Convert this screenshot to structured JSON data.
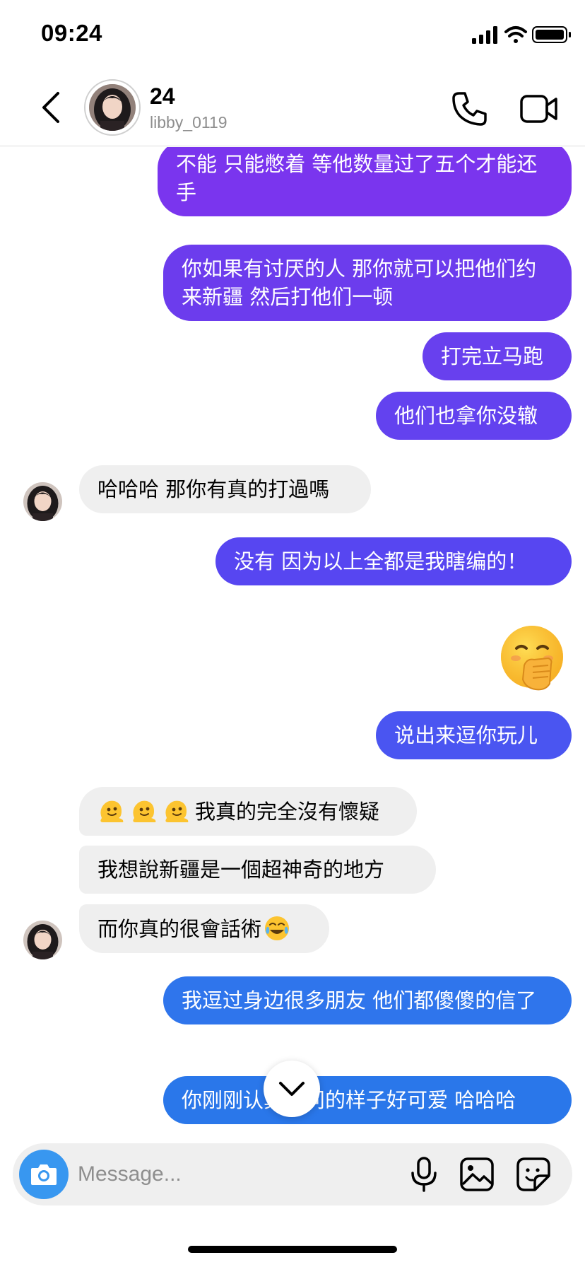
{
  "status_bar": {
    "time": "09:24"
  },
  "header": {
    "contact_name": "24",
    "contact_handle": "libby_0119"
  },
  "messages": [
    {
      "side": "out",
      "text": "不能 只能憋着 等他数量过了五个才能还手"
    },
    {
      "side": "out",
      "text": "你如果有讨厌的人 那你就可以把他们约来新疆 然后打他们一顿"
    },
    {
      "side": "out",
      "text": "打完立马跑"
    },
    {
      "side": "out",
      "text": "他们也拿你没辙"
    },
    {
      "side": "in",
      "text": "哈哈哈 那你有真的打過嗎"
    },
    {
      "side": "out",
      "text": "没有 因为以上全都是我瞎编的！"
    },
    {
      "side": "out",
      "emoji": "face-with-hand-over-mouth"
    },
    {
      "side": "out",
      "text": "说出来逗你玩儿"
    },
    {
      "side": "in",
      "text": "我真的完全沒有懷疑",
      "emoji_prefix": [
        "melting-face",
        "melting-face",
        "melting-face"
      ]
    },
    {
      "side": "in",
      "text": "我想說新疆是一個超神奇的地方"
    },
    {
      "side": "in",
      "text": "而你真的很會話術",
      "emoji_suffix": "face-with-tears-of-joy"
    },
    {
      "side": "out",
      "text": "我逗过身边很多朋友 他们都傻傻的信了"
    },
    {
      "side": "out",
      "text": "你刚刚认真提问的样子好可爱 哈哈哈"
    }
  ],
  "composer": {
    "placeholder": "Message..."
  },
  "colors": {
    "outgoing_purple": "#7a35ee",
    "outgoing_blue_purple": "#5746f1",
    "outgoing_blue": "#2f75ec",
    "incoming": "#efefef",
    "camera_button": "#3897f0"
  }
}
